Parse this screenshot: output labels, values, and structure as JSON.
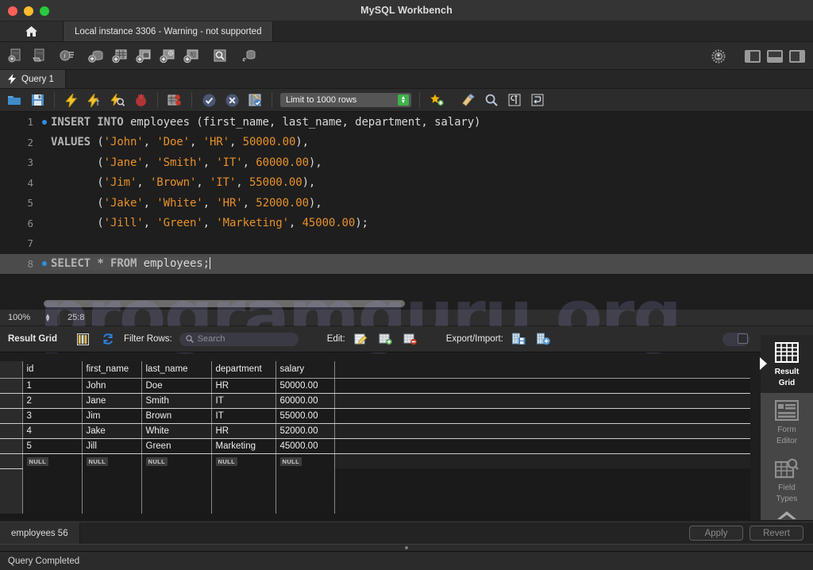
{
  "window": {
    "title": "MySQL Workbench",
    "traffic_lights": [
      "close",
      "minimize",
      "maximize"
    ],
    "colors": {
      "close": "#ff5f57",
      "minimize": "#febc2e",
      "maximize": "#28c840"
    }
  },
  "instance_bar": {
    "home_icon": "home-icon",
    "tab_label": "Local instance 3306 - Warning - not supported"
  },
  "main_toolbar": {
    "icons": [
      "new-sql-file-icon",
      "open-sql-file-icon",
      "inspector-icon",
      "new-schema-icon",
      "new-table-icon",
      "new-view-icon",
      "new-procedure-icon",
      "new-function-icon",
      "search-data-icon",
      "reconnect-dbms-icon"
    ],
    "right_icons": [
      "admin-gear-icon",
      "toggle-sidebar-icon",
      "toggle-output-icon",
      "toggle-secondary-sidebar-icon"
    ]
  },
  "query_tabs": [
    {
      "label": "Query 1",
      "icon": "lightning-icon",
      "active": true
    }
  ],
  "sql_toolbar": {
    "icons": [
      "open-file-icon",
      "save-file-icon",
      "execute-icon",
      "execute-current-icon",
      "explain-icon",
      "stop-icon",
      "toggle-breakpoint-icon",
      "commit-icon",
      "rollback-icon",
      "autocommit-icon"
    ],
    "limit_select": {
      "value": "Limit to 1000 rows"
    },
    "trailing_icons": [
      "beautify-icon",
      "clear-context-icon",
      "find-icon",
      "formatting-icon",
      "wrap-lines-icon"
    ]
  },
  "editor": {
    "zoom": "100%",
    "cursor_position": "25:8",
    "lines": [
      {
        "n": "1",
        "breakpoint": true,
        "selected": false,
        "tokens": [
          {
            "t": "INSERT INTO ",
            "c": "kw"
          },
          {
            "t": "employees ",
            "c": "pn"
          },
          {
            "t": "(first_name, last_name, department, salary)",
            "c": "pn"
          }
        ]
      },
      {
        "n": "2",
        "breakpoint": false,
        "selected": false,
        "tokens": [
          {
            "t": "VALUES ",
            "c": "kw"
          },
          {
            "t": "(",
            "c": "pn"
          },
          {
            "t": "'John'",
            "c": "str"
          },
          {
            "t": ", ",
            "c": "pn"
          },
          {
            "t": "'Doe'",
            "c": "str"
          },
          {
            "t": ", ",
            "c": "pn"
          },
          {
            "t": "'HR'",
            "c": "str"
          },
          {
            "t": ", ",
            "c": "pn"
          },
          {
            "t": "50000.00",
            "c": "num"
          },
          {
            "t": "),",
            "c": "pn"
          }
        ]
      },
      {
        "n": "3",
        "breakpoint": false,
        "selected": false,
        "tokens": [
          {
            "t": "       (",
            "c": "pn"
          },
          {
            "t": "'Jane'",
            "c": "str"
          },
          {
            "t": ", ",
            "c": "pn"
          },
          {
            "t": "'Smith'",
            "c": "str"
          },
          {
            "t": ", ",
            "c": "pn"
          },
          {
            "t": "'IT'",
            "c": "str"
          },
          {
            "t": ", ",
            "c": "pn"
          },
          {
            "t": "60000.00",
            "c": "num"
          },
          {
            "t": "),",
            "c": "pn"
          }
        ]
      },
      {
        "n": "4",
        "breakpoint": false,
        "selected": false,
        "tokens": [
          {
            "t": "       (",
            "c": "pn"
          },
          {
            "t": "'Jim'",
            "c": "str"
          },
          {
            "t": ", ",
            "c": "pn"
          },
          {
            "t": "'Brown'",
            "c": "str"
          },
          {
            "t": ", ",
            "c": "pn"
          },
          {
            "t": "'IT'",
            "c": "str"
          },
          {
            "t": ", ",
            "c": "pn"
          },
          {
            "t": "55000.00",
            "c": "num"
          },
          {
            "t": "),",
            "c": "pn"
          }
        ]
      },
      {
        "n": "5",
        "breakpoint": false,
        "selected": false,
        "tokens": [
          {
            "t": "       (",
            "c": "pn"
          },
          {
            "t": "'Jake'",
            "c": "str"
          },
          {
            "t": ", ",
            "c": "pn"
          },
          {
            "t": "'White'",
            "c": "str"
          },
          {
            "t": ", ",
            "c": "pn"
          },
          {
            "t": "'HR'",
            "c": "str"
          },
          {
            "t": ", ",
            "c": "pn"
          },
          {
            "t": "52000.00",
            "c": "num"
          },
          {
            "t": "),",
            "c": "pn"
          }
        ]
      },
      {
        "n": "6",
        "breakpoint": false,
        "selected": false,
        "tokens": [
          {
            "t": "       (",
            "c": "pn"
          },
          {
            "t": "'Jill'",
            "c": "str"
          },
          {
            "t": ", ",
            "c": "pn"
          },
          {
            "t": "'Green'",
            "c": "str"
          },
          {
            "t": ", ",
            "c": "pn"
          },
          {
            "t": "'Marketing'",
            "c": "str"
          },
          {
            "t": ", ",
            "c": "pn"
          },
          {
            "t": "45000.00",
            "c": "num"
          },
          {
            "t": ");",
            "c": "pn"
          }
        ]
      },
      {
        "n": "7",
        "breakpoint": false,
        "selected": false,
        "tokens": []
      },
      {
        "n": "8",
        "breakpoint": true,
        "selected": true,
        "tokens": [
          {
            "t": "SELECT ",
            "c": "kw"
          },
          {
            "t": "* ",
            "c": "kw"
          },
          {
            "t": "FROM ",
            "c": "kw"
          },
          {
            "t": "employees;",
            "c": "pn"
          }
        ]
      }
    ]
  },
  "result_toolbar": {
    "title": "Result Grid",
    "grid_icon": "grid-columns-icon",
    "refresh_icon": "refresh-icon",
    "filter_label": "Filter Rows:",
    "search_placeholder": "Search",
    "search_value": "",
    "search_icon": "search-icon",
    "edit_label": "Edit:",
    "edit_icons": [
      "edit-row-icon",
      "insert-row-icon",
      "delete-row-icon"
    ],
    "export_label": "Export/Import:",
    "export_icons": [
      "export-recordset-icon",
      "import-recordset-icon"
    ],
    "wrap_toggle": "wrap-cell-content-toggle"
  },
  "result_grid": {
    "columns": [
      "id",
      "first_name",
      "last_name",
      "department",
      "salary"
    ],
    "rows": [
      [
        "1",
        "John",
        "Doe",
        "HR",
        "50000.00"
      ],
      [
        "2",
        "Jane",
        "Smith",
        "IT",
        "60000.00"
      ],
      [
        "3",
        "Jim",
        "Brown",
        "IT",
        "55000.00"
      ],
      [
        "4",
        "Jake",
        "White",
        "HR",
        "52000.00"
      ],
      [
        "5",
        "Jill",
        "Green",
        "Marketing",
        "45000.00"
      ],
      [
        "NULL",
        "NULL",
        "NULL",
        "NULL",
        "NULL"
      ]
    ],
    "null_label": "NULL"
  },
  "side_panel": {
    "items": [
      {
        "label_line1": "Result",
        "label_line2": "Grid",
        "icon": "result-grid-icon",
        "active": true
      },
      {
        "label_line1": "Form",
        "label_line2": "Editor",
        "icon": "form-editor-icon",
        "active": false
      },
      {
        "label_line1": "Field",
        "label_line2": "Types",
        "icon": "field-types-icon",
        "active": false
      }
    ],
    "scroll_up_icon": "chevron-up-icon",
    "scroll_down_icon": "chevron-down-icon"
  },
  "bottom_bar": {
    "tab_label": "employees 56",
    "apply_label": "Apply",
    "revert_label": "Revert"
  },
  "status_bar": {
    "text": "Query Completed"
  },
  "watermark": {
    "text": "programguru.org"
  }
}
